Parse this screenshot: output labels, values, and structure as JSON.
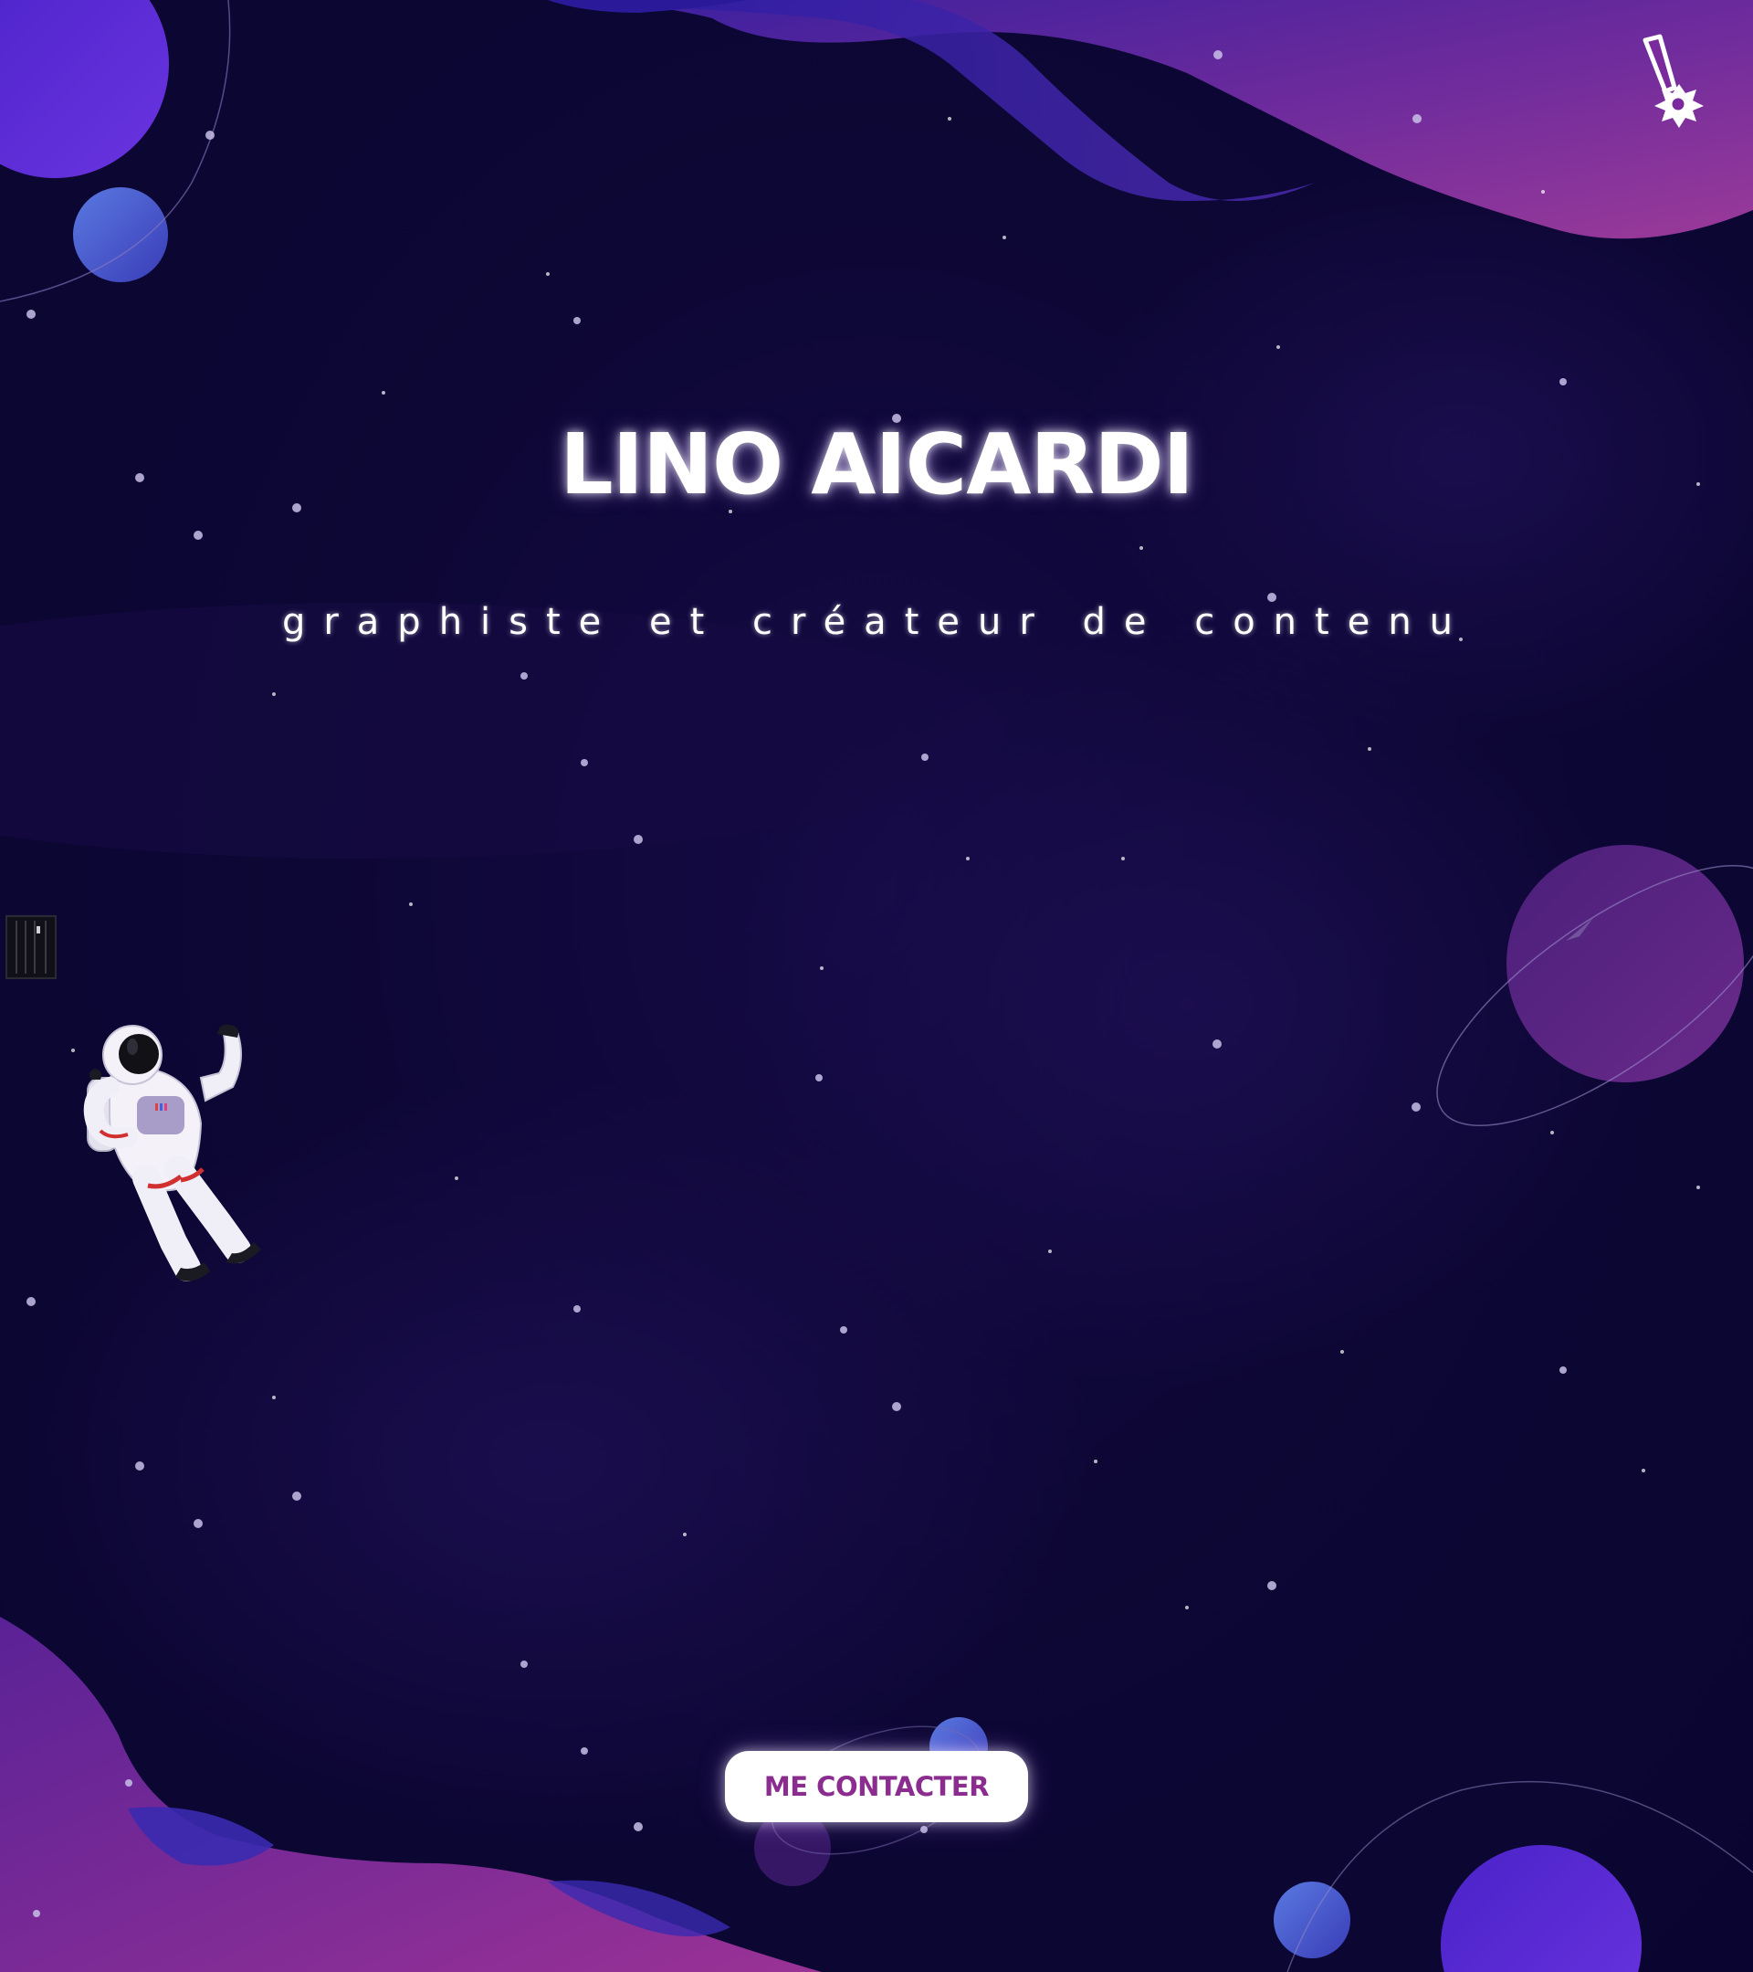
{
  "hero": {
    "title": "LINO AICARDI",
    "subtitle": "graphiste et créateur de contenu"
  },
  "actions": {
    "contact_label": "ME CONTACTER"
  },
  "icons": {
    "notice": "exclamation-burst-icon",
    "side_tab": "sidebar-toggle-icon",
    "astronaut": "astronaut-illustration"
  },
  "colors": {
    "background": "#0b0630",
    "accent_purple": "#8a2d8f",
    "planet_blue": "#4a5fd6",
    "wave_magenta": "#7a2a8c"
  }
}
